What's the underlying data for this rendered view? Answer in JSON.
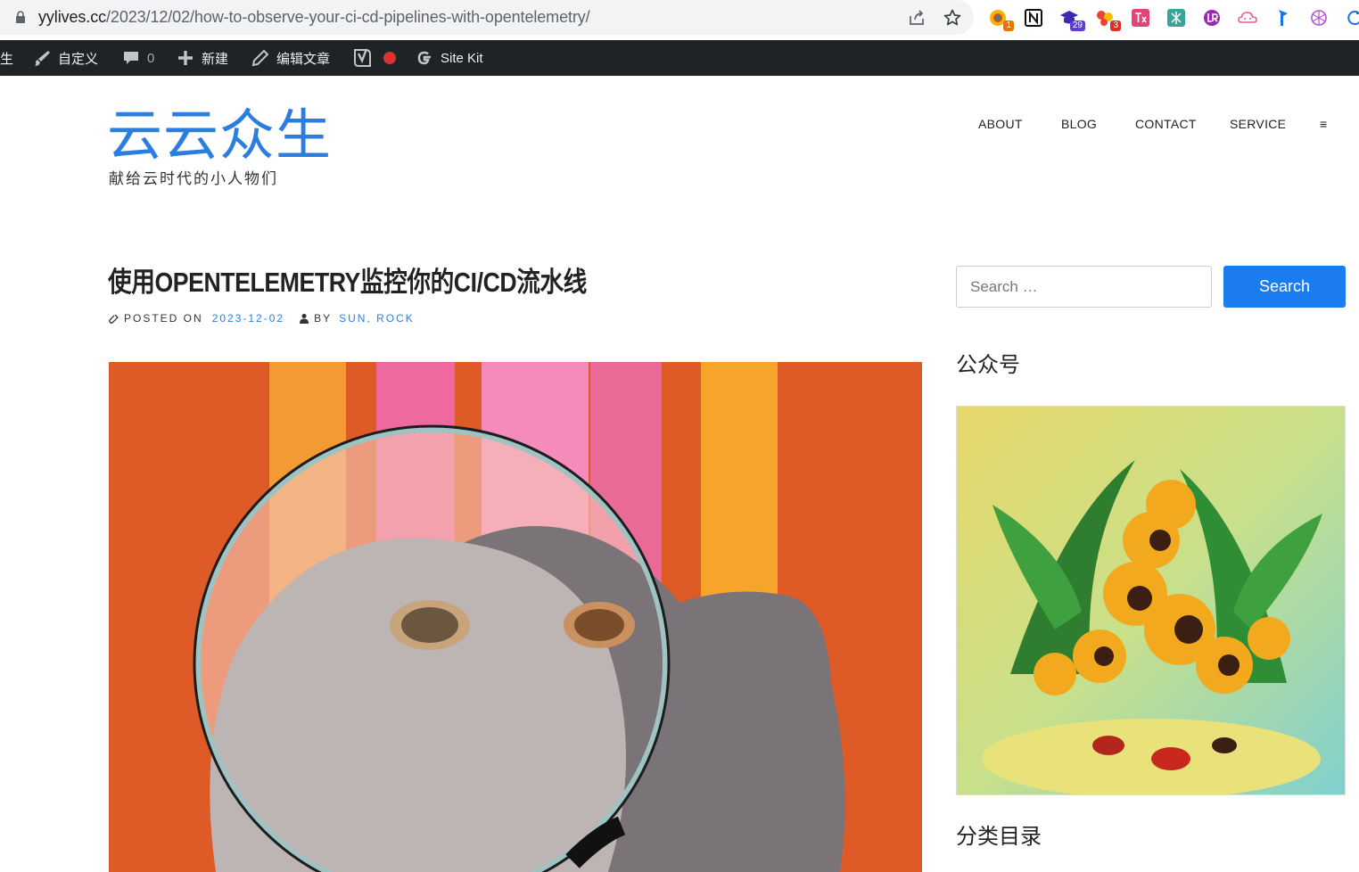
{
  "browser": {
    "url_host": "yylives.cc",
    "url_path": "/2023/12/02/how-to-observe-your-ci-cd-pipelines-with-opentelemetry/",
    "extensions": [
      {
        "icon": "chrome-extension-color-icon",
        "badge": "1",
        "badge_color": "#e37400"
      },
      {
        "icon": "notion-icon",
        "badge": ""
      },
      {
        "icon": "graduation-cap-icon",
        "badge": "29",
        "badge_color": "#5b3fd1"
      },
      {
        "icon": "red-dots-icon",
        "badge": "3",
        "badge_color": "#d93025"
      },
      {
        "icon": "translate-icon",
        "badge": ""
      },
      {
        "icon": "grammar-icon",
        "badge": ""
      },
      {
        "icon": "lr-icon",
        "badge": ""
      },
      {
        "icon": "cloud-icon",
        "badge": ""
      },
      {
        "icon": "bookmark-flag-icon",
        "badge": ""
      },
      {
        "icon": "openai-icon",
        "badge": ""
      },
      {
        "icon": "refresh-icon",
        "badge": ""
      }
    ]
  },
  "adminbar": {
    "site_stub": "生",
    "customize": "自定义",
    "comments_count": "0",
    "new": "新建",
    "edit_post": "编辑文章",
    "site_kit": "Site Kit"
  },
  "site": {
    "title": "云云众生",
    "description": "献给云时代的小人物们",
    "accent": "#2b7de0"
  },
  "nav": {
    "items": [
      "ABOUT",
      "BLOG",
      "CONTACT",
      "SERVICE"
    ],
    "menu_toggle": "≡"
  },
  "post": {
    "title": "使用OPENTELEMETRY监控你的CI/CD流水线",
    "posted_on_label": "POSTED ON",
    "date": "2023-12-02",
    "by_label": "BY",
    "author": "SUN, ROCK"
  },
  "sidebar": {
    "search_placeholder": "Search …",
    "search_button": "Search",
    "widget_wechat_title": "公众号",
    "widget_categories_title": "分类目录"
  }
}
